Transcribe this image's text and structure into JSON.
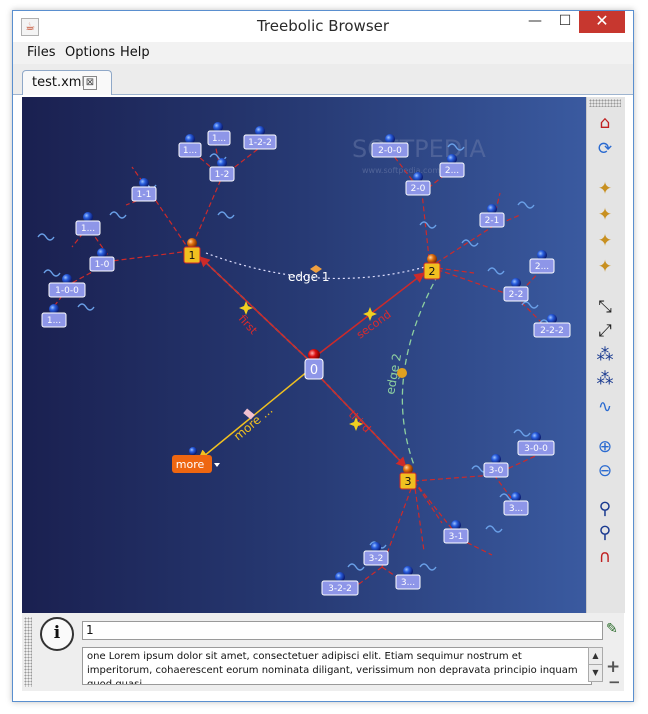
{
  "window": {
    "title": "Treebolic Browser",
    "minimize": "—",
    "maximize": "☐",
    "close": "✕"
  },
  "menu": {
    "files": "Files",
    "options": "Options",
    "help": "Help"
  },
  "tab": {
    "label": "test.xml",
    "close": "⊠"
  },
  "watermark": {
    "main": "SOFTPEDIA",
    "sub": "www.softpedia.com"
  },
  "graph": {
    "edge_labels": {
      "first": "first",
      "second": "second",
      "third": "third",
      "more": "more ...",
      "edge1": "edge 1",
      "edge2": "edge 2"
    },
    "nodes": {
      "root": "0",
      "n1": "1",
      "n1_0": "1-0",
      "n1_0_0": "1-0-0",
      "n1_0_more": "1...",
      "n1_0_more2": "1...",
      "n1_1": "1-1",
      "n1_2": "1-2",
      "n1_2_2": "1-2-2",
      "n1_top_more": "1...",
      "n1_top_more2": "1...",
      "n2": "2",
      "n2_0": "2-0",
      "n2_0_0": "2-0-0",
      "n2_more_top": "2...",
      "n2_1": "2-1",
      "n2_more_right": "2...",
      "n2_2": "2-2",
      "n2_2_2": "2-2-2",
      "n3": "3",
      "n3_0": "3-0",
      "n3_0_0": "3-0-0",
      "n3_more": "3...",
      "n3_1": "3-1",
      "n3_2": "3-2",
      "n3_2_2": "3-2-2",
      "n3_more_bottom": "3...",
      "more": "more"
    }
  },
  "status": {
    "value": "1",
    "description": "one Lorem ipsum dolor sit amet, consectetuer adipisci elit. Etiam sequimur nostrum et imperitorum, cohaerescent eorum nominata diligant, verissimum non depravata principio inquam quod quasi"
  },
  "toolbar_icons": [
    "home-icon",
    "refresh-icon",
    "orientation-north-icon",
    "orientation-south-icon",
    "orientation-east-icon",
    "orientation-west-icon",
    "expand-icon",
    "expand-more-icon",
    "tree-icon",
    "tree-full-icon",
    "edge-icon",
    "zoom-in-icon",
    "zoom-out-icon",
    "find-icon",
    "find-next-icon",
    "magnet-icon"
  ],
  "colors": {
    "accent_red": "#cc2a2a",
    "node_label_bg": "#8e96e8",
    "more_node_bg": "#ee6611",
    "highlight_yellow": "#f0c020",
    "canvas_dark": "#1a2050",
    "canvas_light": "#3a5aa0",
    "dashed_green": "#8ed0a0",
    "edge_dotted": "#e0e0ff"
  }
}
